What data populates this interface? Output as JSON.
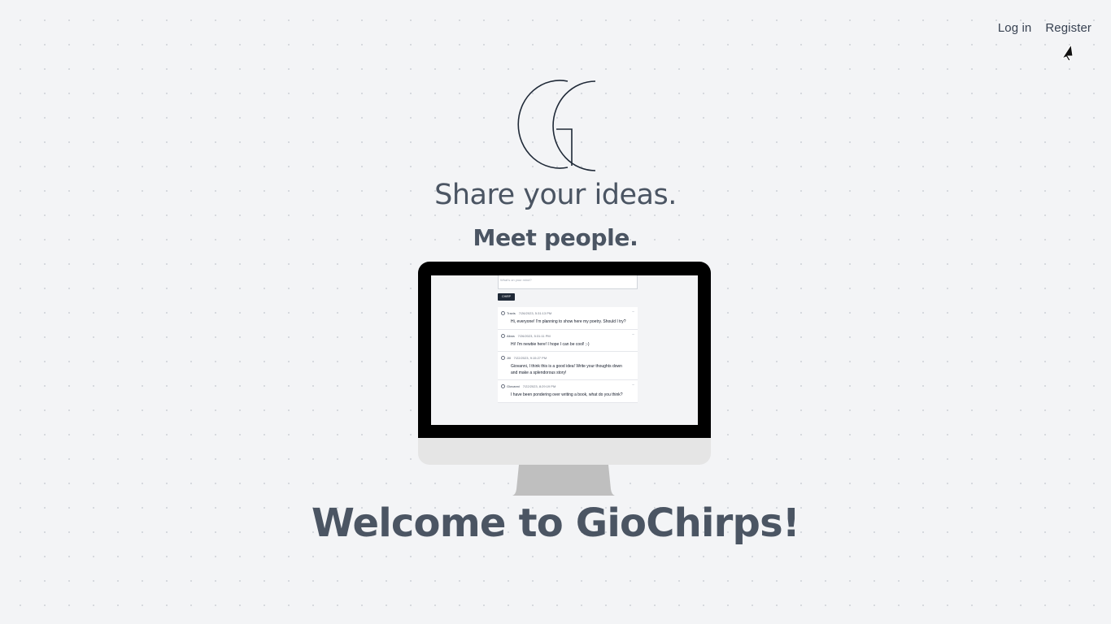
{
  "nav": {
    "login_label": "Log in",
    "register_label": "Register"
  },
  "hero": {
    "logo_letter": "G",
    "line1": "Share your ideas.",
    "line2": "Meet people.",
    "welcome": "Welcome to GioChirps!"
  },
  "preview": {
    "input_placeholder": "What's on your mind?",
    "chirp_button": "CHIRP",
    "chirps": [
      {
        "author": "Travis",
        "date": "7/26/2023, 5:31:13 PM",
        "text": "Hi, everyone! I'm planning to show here my poetry. Should I try?",
        "has_menu": true
      },
      {
        "author": "Alicia",
        "date": "7/26/2023, 5:31:11 PM",
        "text": "Hi! I'm newbie here! I hope I can be cool! ;-)",
        "has_menu": true
      },
      {
        "author": "Jill",
        "date": "7/22/2023, 9:15:27 PM",
        "text": "Giovanni, I think this is a good idea! Write your thoughts down and make a splendorous story!",
        "has_menu": false
      },
      {
        "author": "Giovanni",
        "date": "7/22/2023, 8:29:19 PM",
        "text": "I have been pondering over writing a book, what do you think?",
        "has_menu": true
      }
    ]
  },
  "colors": {
    "background": "#f3f4f6",
    "text": "#4b5563",
    "button": "#1f2937"
  }
}
